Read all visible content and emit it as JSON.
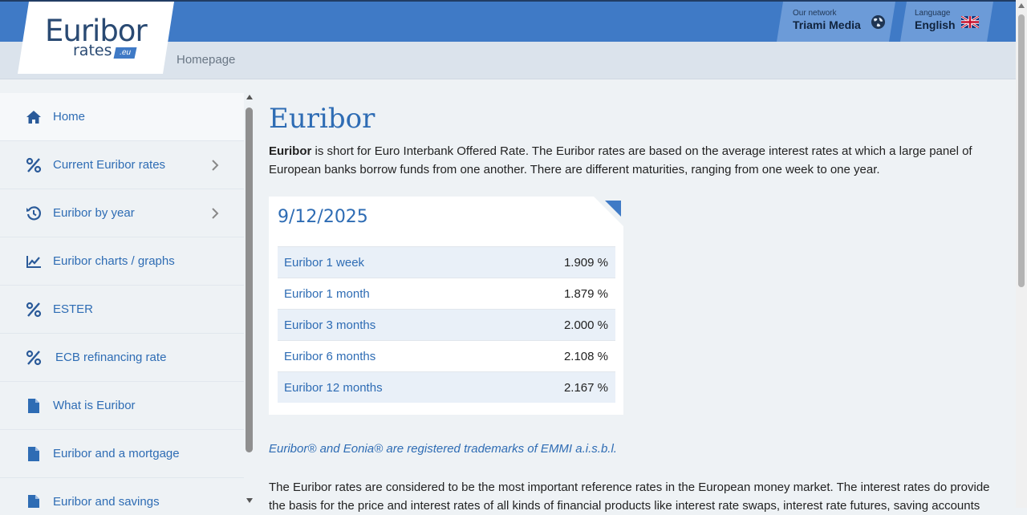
{
  "header": {
    "logo_main": "Euribor",
    "logo_sub": "rates",
    "logo_badge": ".eu",
    "breadcrumb": "Homepage",
    "network_caption": "Our network",
    "network_name": "Triami Media",
    "language_caption": "Language",
    "language_name": "English",
    "color_primary": "#3f7ac6"
  },
  "sidebar": {
    "items": [
      {
        "label": "Home",
        "icon": "home-icon"
      },
      {
        "label": "Current Euribor rates",
        "icon": "percent-icon",
        "chevron": true
      },
      {
        "label": "Euribor by year",
        "icon": "history-icon",
        "chevron": true
      },
      {
        "label": "Euribor charts / graphs",
        "icon": "chart-line-icon"
      },
      {
        "label": "ESTER",
        "icon": "percent-icon"
      },
      {
        "label": "ECB refinancing rate",
        "icon": "percent-icon"
      },
      {
        "label": "What is Euribor",
        "icon": "document-icon"
      },
      {
        "label": "Euribor and a mortgage",
        "icon": "document-icon"
      },
      {
        "label": "Euribor and savings",
        "icon": "document-icon"
      }
    ]
  },
  "main": {
    "title": "Euribor",
    "intro_bold": "Euribor",
    "intro_text": " is short for Euro Interbank Offered Rate. The Euribor rates are based on the average interest rates at which a large panel of European banks borrow funds from one another. There are different maturities, ranging from one week to one year.",
    "card": {
      "date": "9/12/2025",
      "rates": [
        {
          "name": "Euribor 1 week",
          "value": "1.909 %"
        },
        {
          "name": "Euribor 1 month",
          "value": "1.879 %"
        },
        {
          "name": "Euribor 3 months",
          "value": "2.000 %"
        },
        {
          "name": "Euribor 6 months",
          "value": "2.108 %"
        },
        {
          "name": "Euribor 12 months",
          "value": "2.167 %"
        }
      ]
    },
    "trademark": "Euribor® and Eonia® are registered trademarks of EMMI a.i.s.b.l.",
    "paragraph": "The Euribor rates are considered to be the most important reference rates in the European money market. The interest rates do provide the basis for the price and interest rates of all kinds of financial products like interest rate swaps, interest rate futures, saving accounts"
  }
}
